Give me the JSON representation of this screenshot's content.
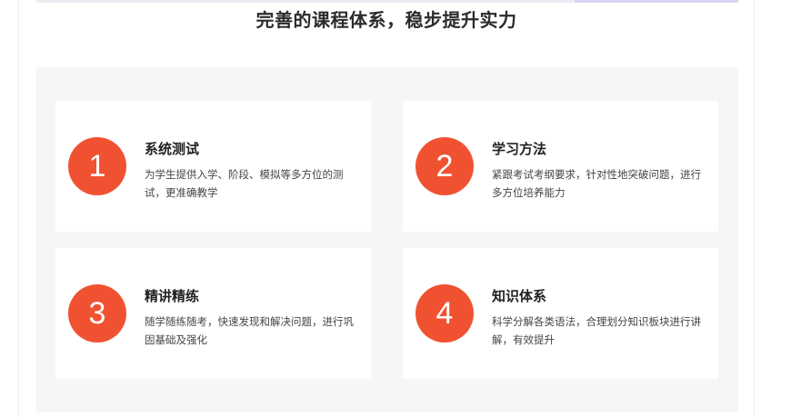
{
  "section": {
    "title": "完善的课程体系，稳步提升实力"
  },
  "features": [
    {
      "number": "1",
      "title": "系统测试",
      "description": "为学生提供入学、阶段、模拟等多方位的测试，更准确教学"
    },
    {
      "number": "2",
      "title": "学习方法",
      "description": "紧跟考试考纲要求，针对性地突破问题，进行多方位培养能力"
    },
    {
      "number": "3",
      "title": "精讲精练",
      "description": "随学随练随考，快速发现和解决问题，进行巩固基础及强化"
    },
    {
      "number": "4",
      "title": "知识体系",
      "description": "科学分解各类语法，合理划分知识板块进行讲解，有效提升"
    }
  ],
  "colors": {
    "accent": "#f05231",
    "panel_bg": "#f6f6f6",
    "card_bg": "#ffffff"
  }
}
